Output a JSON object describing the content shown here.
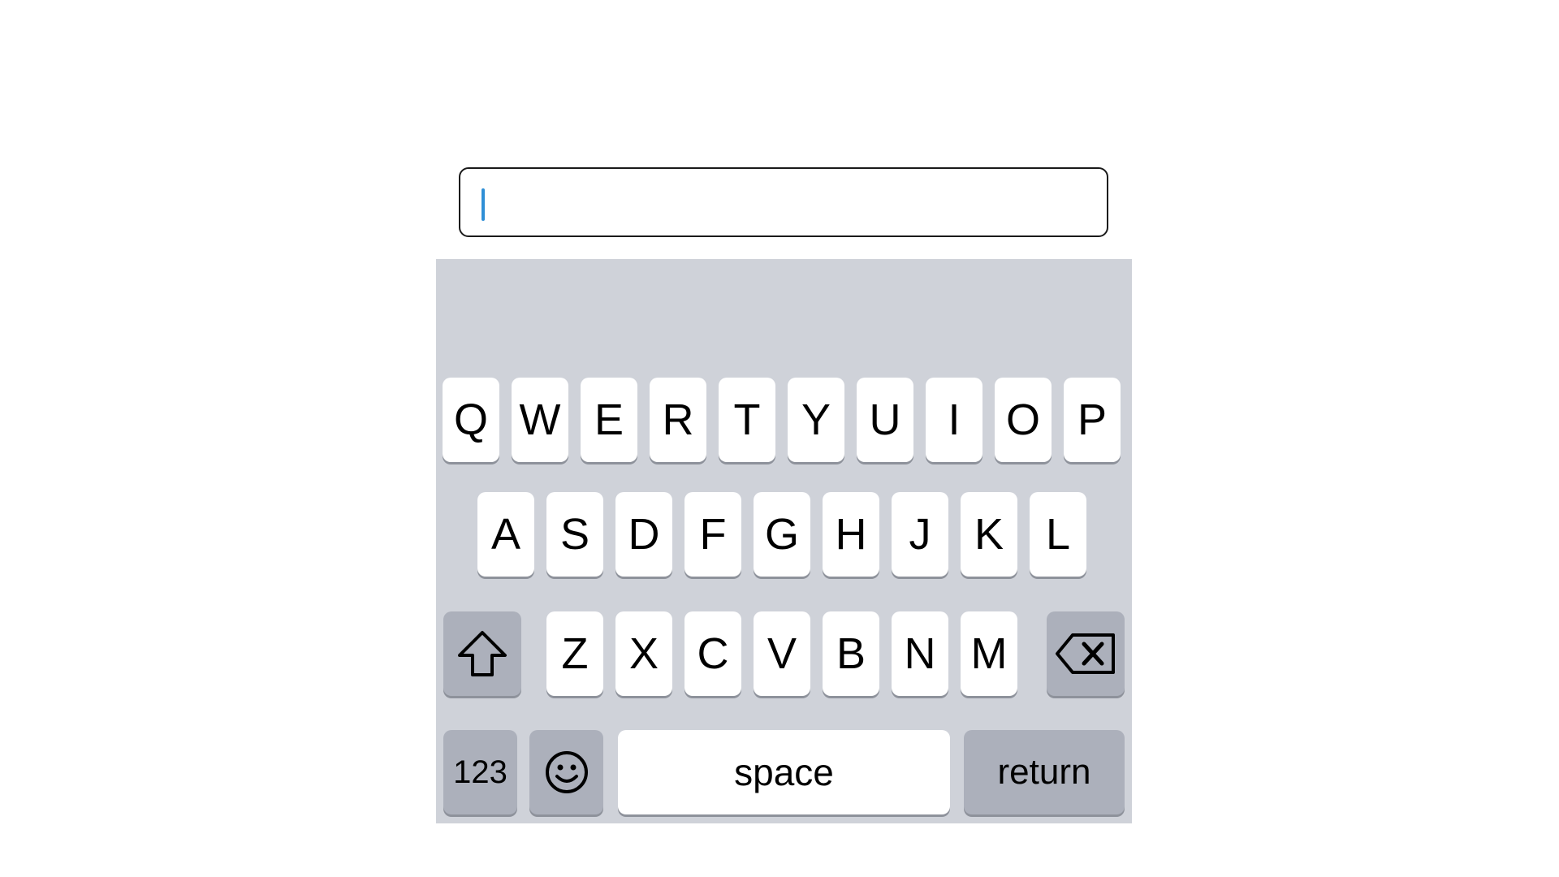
{
  "text_field": {
    "value": "",
    "caret_color": "#2f8fd6"
  },
  "keyboard": {
    "background": "#cfd2d9",
    "row1": [
      "Q",
      "W",
      "E",
      "R",
      "T",
      "Y",
      "U",
      "I",
      "O",
      "P"
    ],
    "row2": [
      "A",
      "S",
      "D",
      "F",
      "G",
      "H",
      "J",
      "K",
      "L"
    ],
    "row3": [
      "Z",
      "X",
      "C",
      "V",
      "B",
      "N",
      "M"
    ],
    "shift": {
      "icon": "shift-arrow-icon"
    },
    "backspace": {
      "icon": "backspace-icon"
    },
    "numbers_label": "123",
    "emoji": {
      "icon": "smiley-icon"
    },
    "space_label": "space",
    "return_label": "return"
  }
}
